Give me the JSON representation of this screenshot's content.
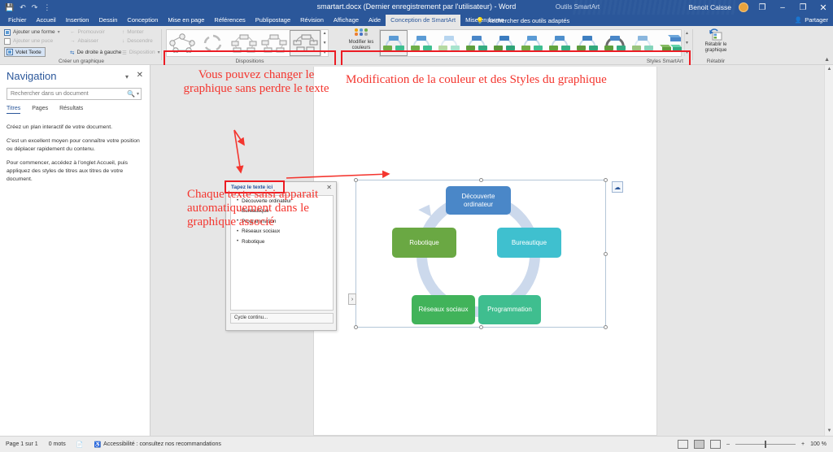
{
  "titlebar": {
    "quick_access": [
      "save-icon",
      "undo-icon",
      "redo-icon",
      "more-icon"
    ],
    "document_title": "smartart.docx (Dernier enregistrement par l'utilisateur)  -  Word",
    "contextual_group": "Outils SmartArt",
    "user_name": "Benoit Caisse",
    "window_buttons": {
      "ribbon_display": "❐",
      "minimize": "–",
      "restore": "❐",
      "close": "✕"
    }
  },
  "tabs": [
    {
      "label": "Fichier",
      "state": "file"
    },
    {
      "label": "Accueil",
      "state": "normal"
    },
    {
      "label": "Insertion",
      "state": "normal"
    },
    {
      "label": "Dessin",
      "state": "normal"
    },
    {
      "label": "Conception",
      "state": "normal"
    },
    {
      "label": "Mise en page",
      "state": "normal"
    },
    {
      "label": "Références",
      "state": "normal"
    },
    {
      "label": "Publipostage",
      "state": "normal"
    },
    {
      "label": "Révision",
      "state": "normal"
    },
    {
      "label": "Affichage",
      "state": "normal"
    },
    {
      "label": "Aide",
      "state": "normal"
    },
    {
      "label": "Conception de SmartArt",
      "state": "active"
    },
    {
      "label": "Mise en forme",
      "state": "normal"
    }
  ],
  "tell_me": "Rechercher des outils adaptés",
  "share": "Partager",
  "ribbon": {
    "create_group": {
      "label": "Créer un graphique",
      "items": [
        {
          "label": "Ajouter une forme",
          "enabled": true,
          "has_dropdown": true
        },
        {
          "label": "Ajouter une puce",
          "enabled": false,
          "has_dropdown": false
        },
        {
          "label": "Volet Texte",
          "enabled": true,
          "toggled": true
        },
        {
          "label": "Promouvoir",
          "enabled": false
        },
        {
          "label": "Abaisser",
          "enabled": false
        },
        {
          "label": "De droite à gauche",
          "enabled": true
        },
        {
          "label": "Monter",
          "enabled": false
        },
        {
          "label": "Descendre",
          "enabled": false
        },
        {
          "label": "Disposition",
          "enabled": false,
          "has_dropdown": true
        }
      ]
    },
    "layouts_group": {
      "label": "Dispositions",
      "gallery_count": 5,
      "selected_index": 4,
      "highlighted": true
    },
    "styles_group": {
      "label": "Styles SmartArt",
      "change_colors_label": "Modifier les couleurs",
      "gallery_count": 11,
      "selected_index": 0,
      "highlighted": true
    },
    "reset_group": {
      "label": "Rétablir",
      "button_label": "Rétablir le graphique"
    }
  },
  "navigation": {
    "title": "Navigation",
    "search_placeholder": "Rechercher dans un document",
    "tabs": [
      {
        "label": "Titres",
        "active": true
      },
      {
        "label": "Pages",
        "active": false
      },
      {
        "label": "Résultats",
        "active": false
      }
    ],
    "paragraphs": [
      "Créez un plan interactif de votre document.",
      "C'est un excellent moyen pour connaître votre position ou déplacer rapidement du contenu.",
      "Pour commencer, accédez à l'onglet Accueil, puis appliquez des styles de titres aux titres de votre document."
    ]
  },
  "text_pane": {
    "title": "Tapez le texte ici",
    "close_label": "✕",
    "items": [
      "Découverte ordinateur",
      "Bureautique",
      "Programmation",
      "Réseaux sociaux",
      "Robotique"
    ],
    "footer": "Cycle continu..."
  },
  "smartart": {
    "layout_name": "Cycle continu",
    "nodes": [
      {
        "label": "Découverte ordinateur",
        "color": "#4a87c8"
      },
      {
        "label": "Bureautique",
        "color": "#3fc0cf"
      },
      {
        "label": "Programmation",
        "color": "#3fbe8f"
      },
      {
        "label": "Réseaux sociaux",
        "color": "#41b35a"
      },
      {
        "label": "Robotique",
        "color": "#6aa843"
      }
    ],
    "ring_color": "#ccd9ec",
    "layout_options_icon": "layout-options-icon"
  },
  "annotations": [
    {
      "id": "anno-layouts",
      "text": "Vous pouvez changer le graphique sans perdre le texte",
      "color": "#f4362f"
    },
    {
      "id": "anno-styles",
      "text": "Modification de la couleur et des Styles du graphique",
      "color": "#f4362f"
    },
    {
      "id": "anno-textpane",
      "text": "Chaque texte saisi apparait automatiquement dans le graphique associé",
      "color": "#f4362f"
    }
  ],
  "statusbar": {
    "page": "Page 1 sur 1",
    "words": "0 mots",
    "proofing_icon": "proofing-icon",
    "accessibility": "Accessibilité : consultez nos recommandations",
    "views": [
      "read-mode-icon",
      "print-layout-icon",
      "web-layout-icon"
    ],
    "zoom_minus": "–",
    "zoom_plus": "+",
    "zoom_level": "100 %"
  },
  "colors": {
    "word_blue": "#2b579a",
    "annotation_red": "#f4362f",
    "highlight_red": "#ec1c24"
  }
}
